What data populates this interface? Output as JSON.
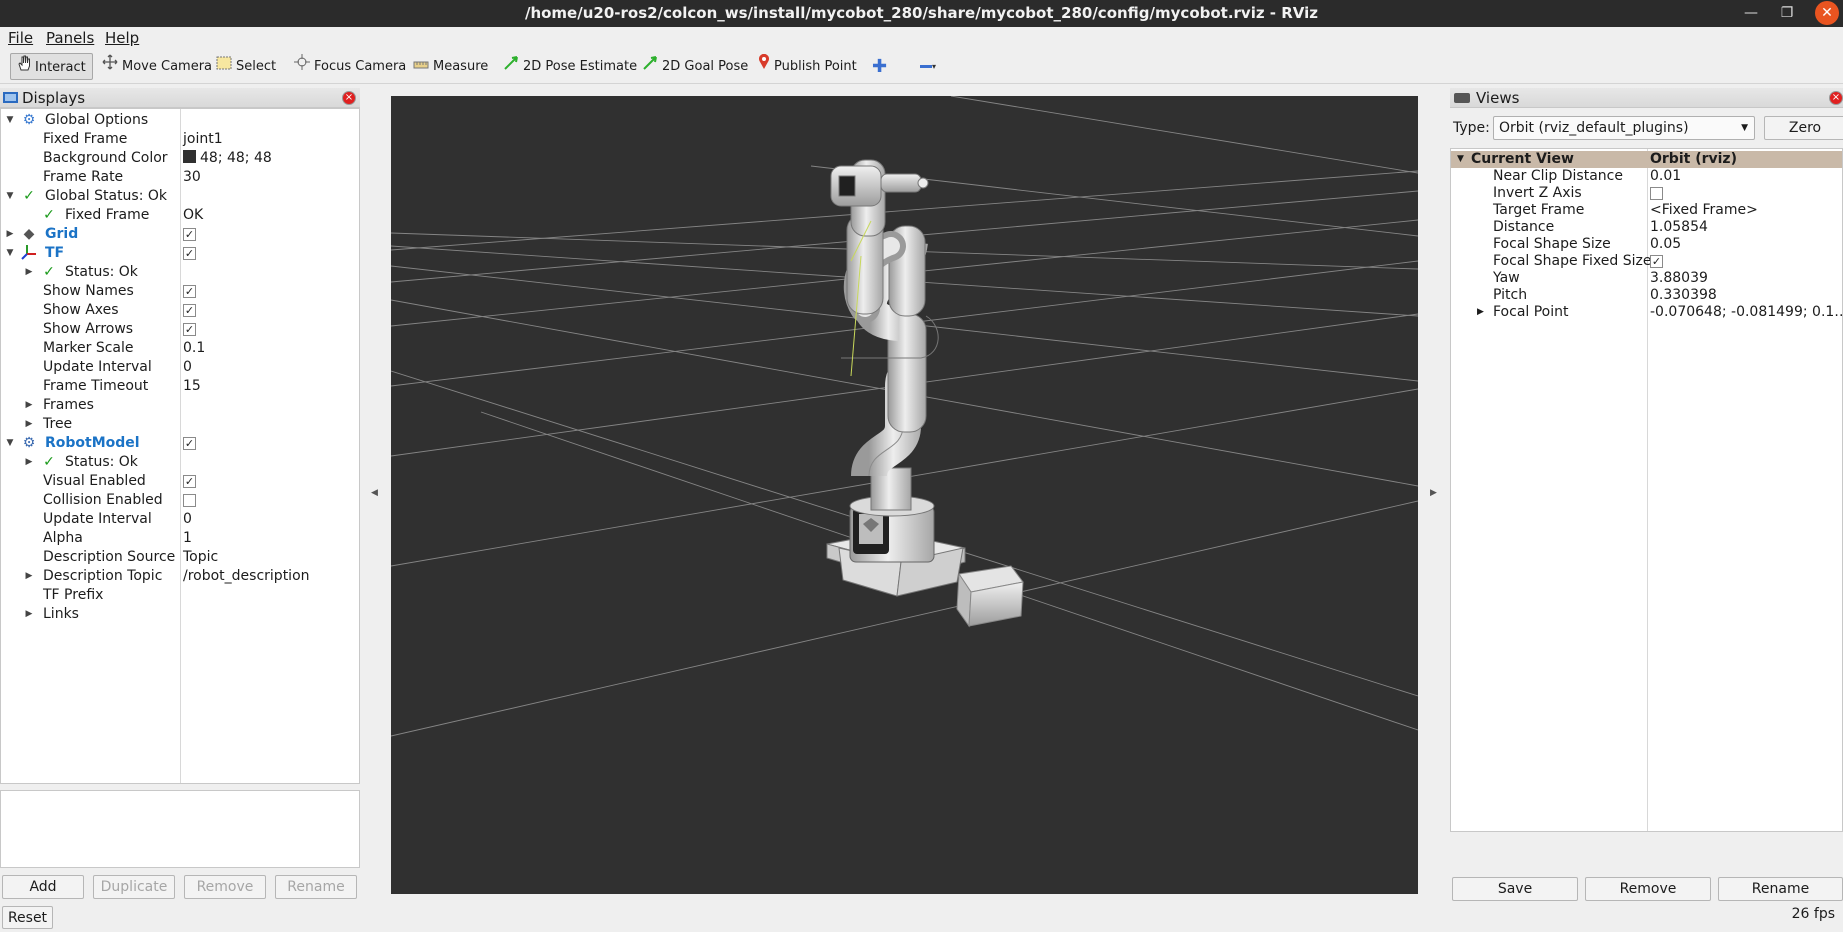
{
  "window": {
    "title": "/home/u20-ros2/colcon_ws/install/mycobot_280/share/mycobot_280/config/mycobot.rviz - RViz"
  },
  "menu": [
    "File",
    "Panels",
    "Help"
  ],
  "toolbar": {
    "interact": "Interact",
    "move_camera": "Move Camera",
    "select": "Select",
    "focus_camera": "Focus Camera",
    "measure": "Measure",
    "pose_estimate": "2D Pose Estimate",
    "goal_pose": "2D Goal Pose",
    "publish_point": "Publish Point"
  },
  "displays": {
    "title": "Displays",
    "rows": [
      {
        "label": "Global Options",
        "value": ""
      },
      {
        "label": "Fixed Frame",
        "value": "joint1"
      },
      {
        "label": "Background Color",
        "value": "48; 48; 48"
      },
      {
        "label": "Frame Rate",
        "value": "30"
      },
      {
        "label": "Global Status: Ok",
        "value": ""
      },
      {
        "label": "Fixed Frame",
        "value": "OK"
      },
      {
        "label": "Grid",
        "value": ""
      },
      {
        "label": "TF",
        "value": ""
      },
      {
        "label": "Status: Ok",
        "value": ""
      },
      {
        "label": "Show Names",
        "value": ""
      },
      {
        "label": "Show Axes",
        "value": ""
      },
      {
        "label": "Show Arrows",
        "value": ""
      },
      {
        "label": "Marker Scale",
        "value": "0.1"
      },
      {
        "label": "Update Interval",
        "value": "0"
      },
      {
        "label": "Frame Timeout",
        "value": "15"
      },
      {
        "label": "Frames",
        "value": ""
      },
      {
        "label": "Tree",
        "value": ""
      },
      {
        "label": "RobotModel",
        "value": ""
      },
      {
        "label": "Status: Ok",
        "value": ""
      },
      {
        "label": "Visual Enabled",
        "value": ""
      },
      {
        "label": "Collision Enabled",
        "value": ""
      },
      {
        "label": "Update Interval",
        "value": "0"
      },
      {
        "label": "Alpha",
        "value": "1"
      },
      {
        "label": "Description Source",
        "value": "Topic"
      },
      {
        "label": "Description Topic",
        "value": "/robot_description"
      },
      {
        "label": "TF Prefix",
        "value": ""
      },
      {
        "label": "Links",
        "value": ""
      }
    ],
    "checks": {
      "grid": true,
      "tf": true,
      "show_names": true,
      "show_axes": true,
      "show_arrows": true,
      "robotmodel": true,
      "visual_enabled": true,
      "collision_enabled": false
    },
    "buttons": {
      "add": "Add",
      "duplicate": "Duplicate",
      "remove": "Remove",
      "rename": "Rename"
    },
    "background_color_hex": "#303030"
  },
  "reset_label": "Reset",
  "views": {
    "title": "Views",
    "type_label": "Type:",
    "type_value": "Orbit (rviz_default_plugins)",
    "zero_label": "Zero",
    "header": {
      "label": "Current View",
      "value": "Orbit (rviz)"
    },
    "rows": [
      {
        "label": "Near Clip Distance",
        "value": "0.01"
      },
      {
        "label": "Invert Z Axis",
        "value": ""
      },
      {
        "label": "Target Frame",
        "value": "<Fixed Frame>"
      },
      {
        "label": "Distance",
        "value": "1.05854"
      },
      {
        "label": "Focal Shape Size",
        "value": "0.05"
      },
      {
        "label": "Focal Shape Fixed Size",
        "value": ""
      },
      {
        "label": "Yaw",
        "value": "3.88039"
      },
      {
        "label": "Pitch",
        "value": "0.330398"
      },
      {
        "label": "Focal Point",
        "value": "-0.070648; -0.081499; 0.1…"
      }
    ],
    "checks": {
      "invert_z": false,
      "focal_fixed": true
    },
    "buttons": {
      "save": "Save",
      "remove": "Remove",
      "rename": "Rename"
    }
  },
  "status": {
    "fps": "26 fps"
  }
}
